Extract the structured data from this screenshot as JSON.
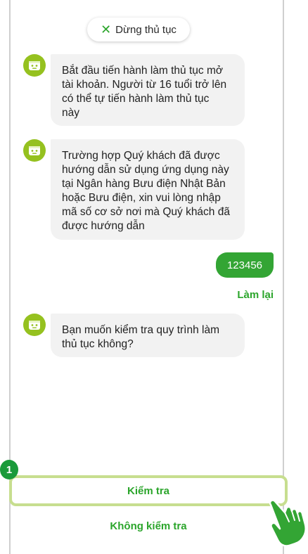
{
  "header": {
    "stop_label": "Dừng thủ tục",
    "stop_icon": "close-x-icon"
  },
  "messages": [
    {
      "from": "bot",
      "text": "Bắt đầu tiến hành làm thủ tục mở\ntài khoản. Người từ 16 tuổi trở lên\ncó thể tự tiến hành làm thủ tục\nnày"
    },
    {
      "from": "bot",
      "text": "Trường hợp Quý khách đã được\nhướng dẫn sử dụng ứng dụng này\ntại Ngân hàng Bưu điện Nhật Bản\nhoặc Bưu điện, xin vui lòng nhập\nmã số cơ sở nơi mà Quý khách đã\nđược hướng dẫn"
    },
    {
      "from": "user",
      "text": "123456"
    },
    {
      "from": "bot",
      "text": "Bạn muốn kiểm tra quy trình làm\nthủ tục không?"
    }
  ],
  "redo_label": "Làm lại",
  "actions": {
    "check_label": "Kiểm tra",
    "no_check_label": "Không kiểm tra"
  },
  "step_badge": "1",
  "colors": {
    "accent_green": "#2ba52b",
    "user_bubble": "#33a534",
    "avatar": "#95c11f",
    "highlight_border": "#c7de8f",
    "badge": "#1a9a3a"
  }
}
